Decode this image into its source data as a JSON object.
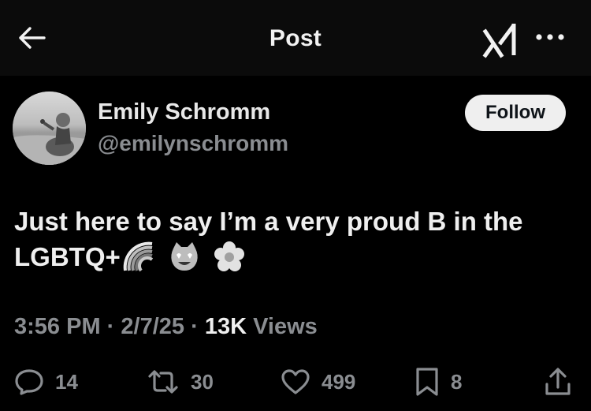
{
  "header": {
    "title": "Post"
  },
  "author": {
    "name": "Emily Schromm",
    "handle": "@emilynschromm",
    "follow_label": "Follow"
  },
  "tweet": {
    "text": "Just here to say I’m a very proud B in the LGBTQ+",
    "emojis": [
      "rainbow",
      "smiling-cat-heart-eyes",
      "white-flower"
    ]
  },
  "meta": {
    "time": "3:56 PM",
    "separator1": " · ",
    "date": "2/7/25",
    "separator2": " · ",
    "views": "13K",
    "views_label": " Views"
  },
  "actions": {
    "replies": "14",
    "reposts": "30",
    "likes": "499",
    "bookmarks": "8"
  },
  "colors": {
    "background": "#000000",
    "text_primary": "#efefef",
    "text_secondary": "#8a8d91",
    "follow_bg": "#efefef"
  }
}
